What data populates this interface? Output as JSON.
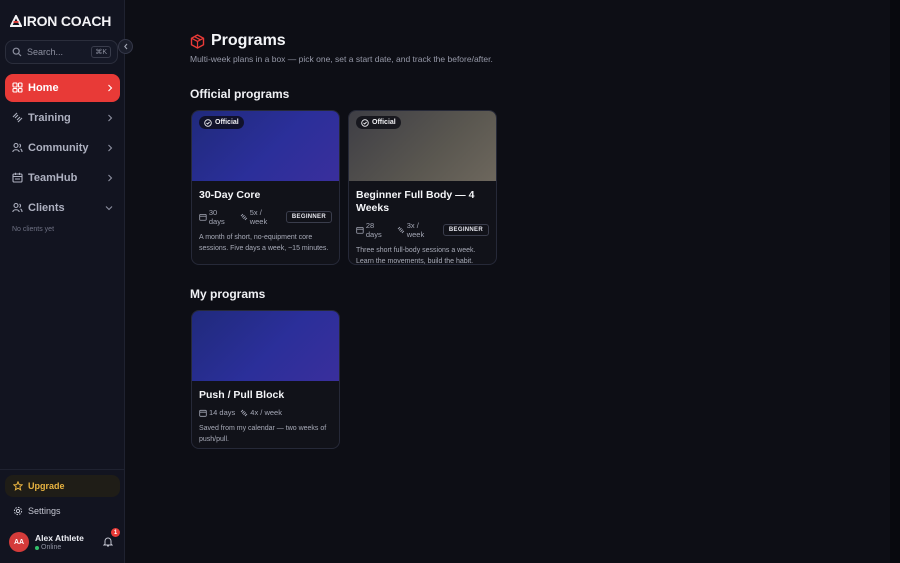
{
  "app": {
    "logo_text": "IRON COACH",
    "accent": "#e83a37"
  },
  "sidebar": {
    "search_placeholder": "Search...",
    "search_shortcut": "⌘K",
    "items": [
      {
        "label": "Home",
        "icon": "grid-icon",
        "active": true
      },
      {
        "label": "Training",
        "icon": "dumbbell-icon"
      },
      {
        "label": "Community",
        "icon": "users-icon"
      },
      {
        "label": "TeamHub",
        "icon": "calendar-icon"
      },
      {
        "label": "Clients",
        "icon": "users-icon",
        "expanded": true
      }
    ],
    "clients_empty": "No clients yet",
    "upgrade_label": "Upgrade",
    "settings_label": "Settings",
    "user": {
      "initials": "AA",
      "name": "Alex Athlete",
      "status": "Online",
      "notifications": "1"
    }
  },
  "page": {
    "title": "Programs",
    "subtitle": "Multi-week plans in a box — pick one, set a start date, and track the before/after."
  },
  "official": {
    "section_title": "Official programs",
    "cards": [
      {
        "badge": "Official",
        "title": "30-Day Core",
        "days": "30 days",
        "frequency": "5x / week",
        "level": "BEGINNER",
        "description": "A month of short, no-equipment core sessions. Five days a week, ~15 minutes."
      },
      {
        "badge": "Official",
        "title": "Beginner Full Body — 4 Weeks",
        "days": "28 days",
        "frequency": "3x / week",
        "level": "BEGINNER",
        "description": "Three short full-body sessions a week. Learn the movements, build the habit."
      }
    ]
  },
  "mine": {
    "section_title": "My programs",
    "cards": [
      {
        "title": "Push / Pull Block",
        "days": "14 days",
        "frequency": "4x / week",
        "description": "Saved from my calendar — two weeks of push/pull."
      }
    ]
  }
}
